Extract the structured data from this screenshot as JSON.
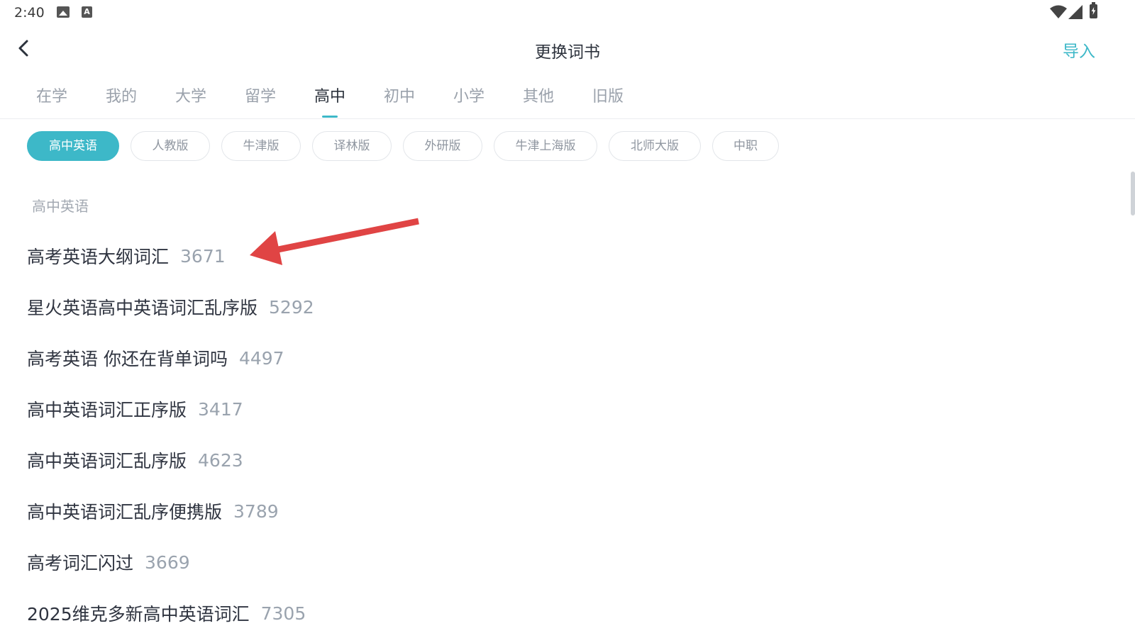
{
  "status_bar": {
    "time": "2:40",
    "left_icons": [
      "image-icon",
      "a-icon"
    ],
    "right_icons": [
      "wifi-icon",
      "signal-icon",
      "battery-charging-icon"
    ]
  },
  "header": {
    "back_icon": "chevron-left-icon",
    "title": "更换词书",
    "import_label": "导入"
  },
  "tabs": [
    {
      "label": "在学",
      "active": false
    },
    {
      "label": "我的",
      "active": false
    },
    {
      "label": "大学",
      "active": false
    },
    {
      "label": "留学",
      "active": false
    },
    {
      "label": "高中",
      "active": true
    },
    {
      "label": "初中",
      "active": false
    },
    {
      "label": "小学",
      "active": false
    },
    {
      "label": "其他",
      "active": false
    },
    {
      "label": "旧版",
      "active": false
    }
  ],
  "chips": [
    {
      "label": "高中英语",
      "active": true
    },
    {
      "label": "人教版",
      "active": false
    },
    {
      "label": "牛津版",
      "active": false
    },
    {
      "label": "译林版",
      "active": false
    },
    {
      "label": "外研版",
      "active": false
    },
    {
      "label": "牛津上海版",
      "active": false
    },
    {
      "label": "北师大版",
      "active": false
    },
    {
      "label": "中职",
      "active": false
    }
  ],
  "section": {
    "title": "高中英语"
  },
  "books": [
    {
      "name": "高考英语大纲词汇",
      "count": "3671"
    },
    {
      "name": "星火英语高中英语词汇乱序版",
      "count": "5292"
    },
    {
      "name": "高考英语 你还在背单词吗",
      "count": "4497"
    },
    {
      "name": "高中英语词汇正序版",
      "count": "3417"
    },
    {
      "name": "高中英语词汇乱序版",
      "count": "4623"
    },
    {
      "name": "高中英语词汇乱序便携版",
      "count": "3789"
    },
    {
      "name": "高考词汇闪过",
      "count": "3669"
    },
    {
      "name": "2025维克多新高中英语词汇",
      "count": "7305"
    }
  ],
  "colors": {
    "accent": "#3db8c8",
    "annotation_arrow": "#e04444",
    "text_primary": "#2f3440",
    "text_secondary": "#9aa3ae"
  }
}
